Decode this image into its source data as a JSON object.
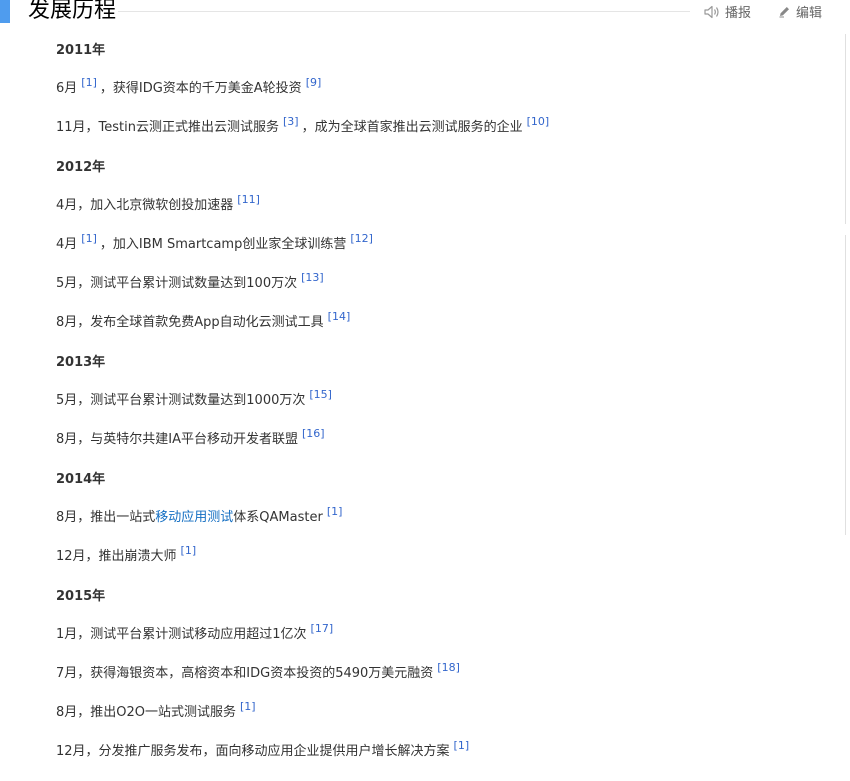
{
  "section": {
    "title": "发展历程"
  },
  "tools": {
    "play_label": "播报",
    "edit_label": "编辑"
  },
  "timeline": [
    {
      "year": "2011年"
    },
    {
      "parts": [
        {
          "t": "6月"
        },
        {
          "r": "[1]"
        },
        {
          "t": "，获得IDG资本的千万美金A轮投资"
        },
        {
          "r": "[9]"
        }
      ]
    },
    {
      "parts": [
        {
          "t": "11月，Testin云测正式推出云测试服务"
        },
        {
          "r": "[3]"
        },
        {
          "t": "，成为全球首家推出云测试服务的企业"
        },
        {
          "r": "[10]"
        }
      ]
    },
    {
      "year": "2012年"
    },
    {
      "parts": [
        {
          "t": "4月，加入北京微软创投加速器"
        },
        {
          "r": "[11]"
        }
      ]
    },
    {
      "parts": [
        {
          "t": "4月"
        },
        {
          "r": "[1]"
        },
        {
          "t": "，加入IBM Smartcamp创业家全球训练营"
        },
        {
          "r": "[12]"
        }
      ]
    },
    {
      "parts": [
        {
          "t": "5月，测试平台累计测试数量达到100万次"
        },
        {
          "r": "[13]"
        }
      ]
    },
    {
      "parts": [
        {
          "t": "8月，发布全球首款免费App自动化云测试工具"
        },
        {
          "r": "[14]"
        }
      ]
    },
    {
      "year": "2013年"
    },
    {
      "parts": [
        {
          "t": "5月，测试平台累计测试数量达到1000万次"
        },
        {
          "r": "[15]"
        }
      ]
    },
    {
      "parts": [
        {
          "t": "8月，与英特尔共建IA平台移动开发者联盟"
        },
        {
          "r": "[16]"
        }
      ]
    },
    {
      "year": "2014年"
    },
    {
      "parts": [
        {
          "t": "8月，推出一站式"
        },
        {
          "l": "移动应用测试"
        },
        {
          "t": "体系QAMaster"
        },
        {
          "r": "[1]"
        }
      ]
    },
    {
      "parts": [
        {
          "t": "12月，推出崩溃大师"
        },
        {
          "r": "[1]"
        }
      ]
    },
    {
      "year": "2015年"
    },
    {
      "parts": [
        {
          "t": "1月，测试平台累计测试移动应用超过1亿次"
        },
        {
          "r": "[17]"
        }
      ]
    },
    {
      "parts": [
        {
          "t": "7月，获得海银资本，高榕资本和IDG资本投资的5490万美元融资"
        },
        {
          "r": "[18]"
        }
      ]
    },
    {
      "parts": [
        {
          "t": "8月，推出O2O一站式测试服务"
        },
        {
          "r": "[1]"
        }
      ]
    },
    {
      "parts": [
        {
          "t": "12月，分发推广服务发布，面向移动应用企业提供用户增长解决方案"
        },
        {
          "r": "[1]"
        }
      ]
    }
  ],
  "colors": {
    "accent": "#4f9cee",
    "link": "#136ec2",
    "ref": "#3366cc",
    "text": "#333333"
  },
  "icons": {
    "play": "speaker-icon",
    "edit": "pencil-icon"
  }
}
